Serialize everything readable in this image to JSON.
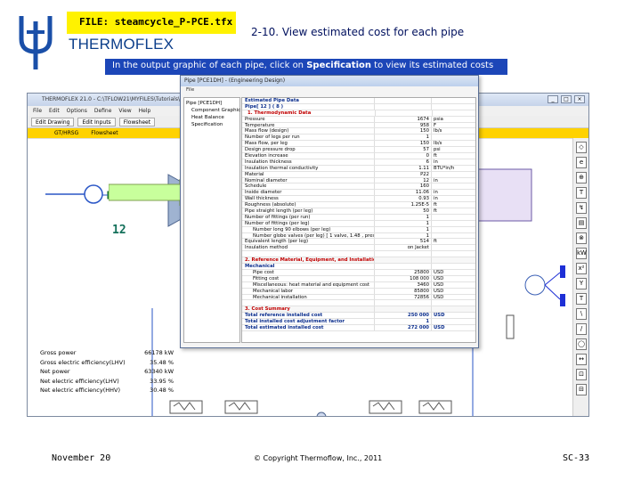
{
  "header": {
    "file_badge": "FILE: steamcycle_P-PCE.tfx",
    "brand": "THERMOFLEX",
    "slide_title": "2-10. View estimated cost for each pipe",
    "instruction_pre": "In the output graphic of each pipe, click on ",
    "instruction_bold": "Specification",
    "instruction_post": " to view its estimated costs"
  },
  "app": {
    "title": "THERMOFLEX 21.0 - C:\\TFLOW21\\MYFILES\\Tutorials\\TFX Steam Cycle",
    "menu": [
      "File",
      "Edit",
      "Options",
      "Define",
      "View",
      "Help"
    ],
    "toolbar": [
      "Edit Drawing",
      "Edit Inputs",
      "Flowsheet"
    ],
    "tabs": [
      "GT/HRSG",
      "Flowsheet"
    ],
    "stream_label": "12",
    "results": [
      {
        "label": "Gross power",
        "value": "66178 kW"
      },
      {
        "label": "Gross electric efficiency(LHV)",
        "value": "35.48 %"
      },
      {
        "label": "Net power",
        "value": "63340 kW"
      },
      {
        "label": "Net electric efficiency(LHV)",
        "value": "33.95 %"
      },
      {
        "label": "Net electric efficiency(HHV)",
        "value": "30.48 %"
      }
    ],
    "palette_icons": [
      "◇",
      "e",
      "⊕",
      "T",
      "↯",
      "▤",
      "⊗",
      "kW",
      "x²",
      "Y",
      "T",
      "\\",
      "/",
      "◯",
      "↔",
      "⊡",
      "⊟"
    ]
  },
  "popup": {
    "title": "Pipe [PCE1DH] - (Engineering Design)",
    "menu": "File",
    "tree": [
      "Pipe [PCE1DH]",
      "Component Graphic",
      "Heat Balance",
      "Specification"
    ],
    "rows": [
      {
        "t": "head",
        "k": "Estimated Pipe Data",
        "v": "",
        "u": ""
      },
      {
        "t": "blue",
        "k": "Pipe[ 12 ] ( 8 )",
        "v": "",
        "u": ""
      },
      {
        "t": "sub",
        "k": "1. Thermodynamic Data",
        "v": "",
        "u": ""
      },
      {
        "t": "",
        "k": "Pressure",
        "v": "1674",
        "u": "psia"
      },
      {
        "t": "",
        "k": "Temperature",
        "v": "958",
        "u": "F"
      },
      {
        "t": "",
        "k": "Mass flow (design)",
        "v": "150",
        "u": "lb/s"
      },
      {
        "t": "",
        "k": "Number of legs per run",
        "v": "1",
        "u": ""
      },
      {
        "t": "",
        "k": "Mass flow, per leg",
        "v": "150",
        "u": "lb/s"
      },
      {
        "t": "",
        "k": "Design pressure drop",
        "v": "57",
        "u": "psi"
      },
      {
        "t": "",
        "k": "Elevation increase",
        "v": "0",
        "u": "ft"
      },
      {
        "t": "",
        "k": "Insulation thickness",
        "v": "6",
        "u": "in"
      },
      {
        "t": "",
        "k": "Insulation thermal conductivity",
        "v": "1.11",
        "u": "BTU*in/h"
      },
      {
        "t": "",
        "k": "Material",
        "v": "P22",
        "u": ""
      },
      {
        "t": "",
        "k": "Nominal diameter",
        "v": "12",
        "u": "in"
      },
      {
        "t": "",
        "k": "Schedule",
        "v": "160",
        "u": ""
      },
      {
        "t": "",
        "k": "Inside diameter",
        "v": "11.06",
        "u": "in"
      },
      {
        "t": "",
        "k": "Wall thickness",
        "v": "0.93",
        "u": "in"
      },
      {
        "t": "",
        "k": "Roughness (absolute)",
        "v": "1.25E-5",
        "u": "ft"
      },
      {
        "t": "",
        "k": "Pipe straight length (per leg)",
        "v": "50",
        "u": "ft"
      },
      {
        "t": "",
        "k": "Number of fittings (per run)",
        "v": "1",
        "u": ""
      },
      {
        "t": "",
        "k": "Number of fittings (per leg)",
        "v": "1",
        "u": ""
      },
      {
        "t": "ind",
        "k": "Number long 90 elbows (per leg)",
        "v": "1",
        "u": ""
      },
      {
        "t": "ind",
        "k": "Number globe valves (per leg) [ 1 valve, 1.48 , pressure class 900 psi, 450 lb/s ]",
        "v": "1",
        "u": ""
      },
      {
        "t": "",
        "k": "Equivalent length (per leg)",
        "v": "514",
        "u": "ft"
      },
      {
        "t": "",
        "k": "Insulation method",
        "v": "on Jacket",
        "u": ""
      },
      {
        "t": "",
        "k": "",
        "v": "",
        "u": ""
      },
      {
        "t": "sec",
        "k": "2. Reference Material, Equipment, and Installation Costs",
        "v": "",
        "u": ""
      },
      {
        "t": "blue",
        "k": "Mechanical",
        "v": "",
        "u": ""
      },
      {
        "t": "ind",
        "k": "Pipe cost",
        "v": "25800",
        "u": "USD"
      },
      {
        "t": "ind",
        "k": "Fitting cost",
        "v": "108 000",
        "u": "USD"
      },
      {
        "t": "ind",
        "k": "Miscellaneous: heat material and equipment cost",
        "v": "3460",
        "u": "USD"
      },
      {
        "t": "ind",
        "k": "Mechanical labor",
        "v": "85800",
        "u": "USD"
      },
      {
        "t": "ind",
        "k": "Mechanical installation",
        "v": "72856",
        "u": "USD"
      },
      {
        "t": "",
        "k": "",
        "v": "",
        "u": ""
      },
      {
        "t": "sec",
        "k": "3. Cost Summary",
        "v": "",
        "u": ""
      },
      {
        "t": "blue",
        "k": "Total reference installed cost",
        "v": "250 000",
        "u": "USD"
      },
      {
        "t": "blue",
        "k": "Total installed cost adjustment factor",
        "v": "1",
        "u": ""
      },
      {
        "t": "blue",
        "k": "Total estimated installed cost",
        "v": "272 000",
        "u": "USD"
      }
    ]
  },
  "footer": {
    "date": "November 20",
    "copyright": "© Copyright Thermoflow, Inc., 2011",
    "page": "SC-33"
  },
  "colors": {
    "accent_blue": "#1c46b8",
    "badge_yellow": "#fff200",
    "section_red": "#c00000",
    "brand_blue": "#0b3e8a"
  }
}
